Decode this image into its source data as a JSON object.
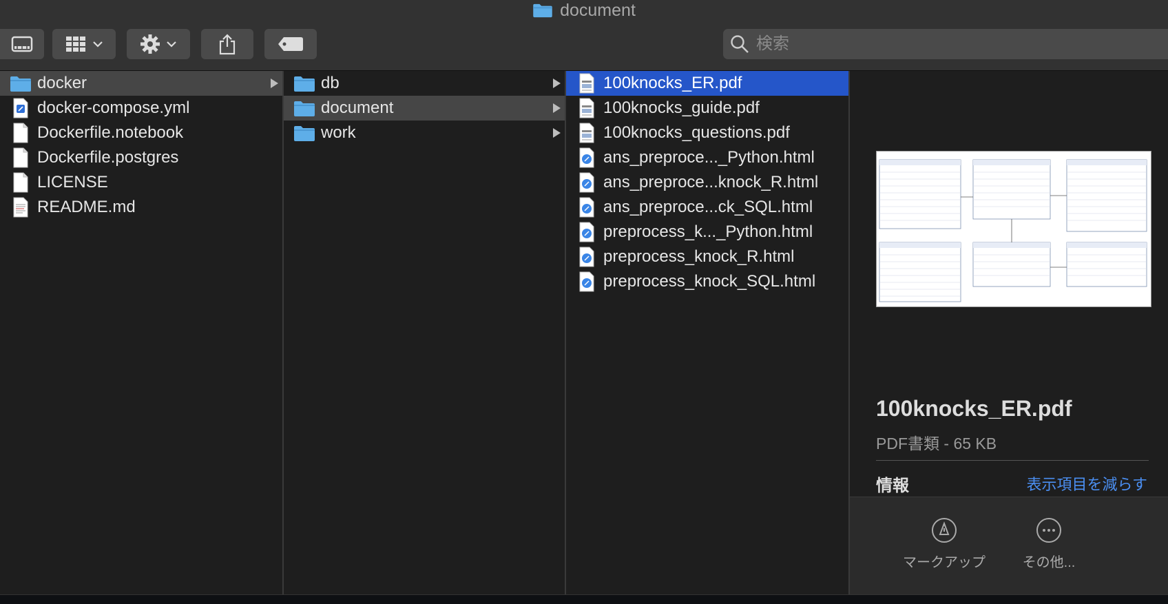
{
  "window": {
    "title": "document"
  },
  "toolbar": {
    "search_placeholder": "検索"
  },
  "columns": [
    {
      "items": [
        {
          "name": "docker",
          "type": "folder",
          "selected": "gray",
          "arrow": true
        },
        {
          "name": "docker-compose.yml",
          "type": "yml"
        },
        {
          "name": "Dockerfile.notebook",
          "type": "blank"
        },
        {
          "name": "Dockerfile.postgres",
          "type": "blank"
        },
        {
          "name": "LICENSE",
          "type": "blank"
        },
        {
          "name": "README.md",
          "type": "text"
        }
      ]
    },
    {
      "items": [
        {
          "name": "db",
          "type": "folder",
          "arrow": true
        },
        {
          "name": "document",
          "type": "folder",
          "selected": "gray",
          "arrow": true
        },
        {
          "name": "work",
          "type": "folder",
          "arrow": true
        }
      ]
    },
    {
      "items": [
        {
          "name": "100knocks_ER.pdf",
          "type": "pdf",
          "selected": "blue"
        },
        {
          "name": "100knocks_guide.pdf",
          "type": "pdf"
        },
        {
          "name": "100knocks_questions.pdf",
          "type": "pdf"
        },
        {
          "name": "ans_preproce..._Python.html",
          "type": "html"
        },
        {
          "name": "ans_preproce...knock_R.html",
          "type": "html"
        },
        {
          "name": "ans_preproce...ck_SQL.html",
          "type": "html"
        },
        {
          "name": "preprocess_k..._Python.html",
          "type": "html"
        },
        {
          "name": "preprocess_knock_R.html",
          "type": "html"
        },
        {
          "name": "preprocess_knock_SQL.html",
          "type": "html"
        }
      ]
    }
  ],
  "preview": {
    "file_name": "100knocks_ER.pdf",
    "meta": "PDF書類 - 65 KB",
    "info_heading": "情報",
    "show_less": "表示項目を減らす",
    "actions": [
      {
        "label": "マークアップ",
        "icon": "markup-icon"
      },
      {
        "label": "その他...",
        "icon": "more-icon"
      }
    ]
  },
  "colors": {
    "selection_blue": "#2556c9",
    "selection_gray": "#464646",
    "folder_blue": "#5eaee8",
    "link_blue": "#4b8ff2"
  }
}
